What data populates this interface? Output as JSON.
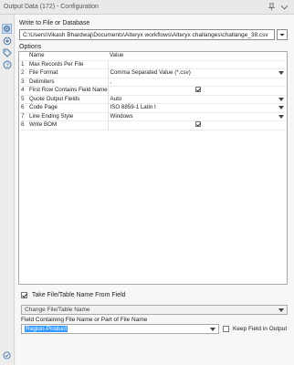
{
  "window": {
    "title": "Output Data (172) - Configuration"
  },
  "toolbar_icons": [
    "settings-icon",
    "connection-icon",
    "tag-icon",
    "help-icon"
  ],
  "write_to": {
    "label": "Write to File or Database",
    "path": "C:\\Users\\Vikash Bhardwaj\\Documents\\Alteryx workflows\\Alteryx challanges\\challange_38.csv"
  },
  "options": {
    "label": "Options",
    "headers": {
      "name": "Name",
      "value": "Value"
    },
    "rows": [
      {
        "num": "1",
        "name": "Max Records Per File",
        "value": "",
        "control": "text"
      },
      {
        "num": "2",
        "name": "File Format",
        "value": "Comma Separated Value (*.csv)",
        "control": "dropdown"
      },
      {
        "num": "3",
        "name": "Delimiters",
        "value": ",",
        "control": "text"
      },
      {
        "num": "4",
        "name": "First Row Contains Field Names",
        "value": "",
        "control": "checkbox",
        "checked": true
      },
      {
        "num": "5",
        "name": "Quote Output Fields",
        "value": "Auto",
        "control": "dropdown"
      },
      {
        "num": "6",
        "name": "Code Page",
        "value": "ISO 8859-1 Latin I",
        "control": "dropdown"
      },
      {
        "num": "7",
        "name": "Line Ending Style",
        "value": "Windows",
        "control": "dropdown"
      },
      {
        "num": "8",
        "name": "Write BOM",
        "value": "",
        "control": "checkbox",
        "checked": true
      }
    ]
  },
  "take_from_field": {
    "checkbox_label": "Take File/Table Name From Field",
    "checked": true,
    "mode_value": "Change File/Table Name",
    "field_label": "Field Containing File Name or Part of File Name",
    "field_value": "Region-Product",
    "keep_label": "Keep Field in Output",
    "keep_checked": false
  },
  "colors": {
    "accent": "#3399ff",
    "selected_tool_bg": "#c9daf0"
  }
}
